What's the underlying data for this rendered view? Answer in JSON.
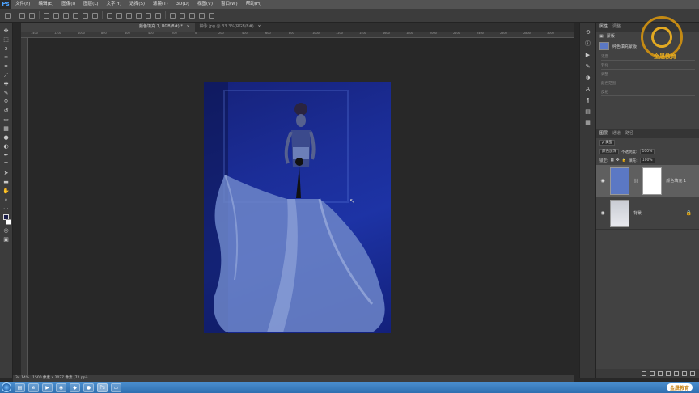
{
  "app": {
    "logo": "Ps"
  },
  "menu": [
    "文件(F)",
    "编辑(E)",
    "图像(I)",
    "图层(L)",
    "文字(Y)",
    "选择(S)",
    "滤镜(T)",
    "3D(D)",
    "视图(V)",
    "窗口(W)",
    "帮助(H)"
  ],
  "tabs": [
    {
      "label": "颜色填充 1, RGB/8#) *",
      "close": "×"
    },
    {
      "label": "钟泳.jpg @ 33.3%(RGB/8#)",
      "close": "×"
    }
  ],
  "ruler_ticks": [
    "1400",
    "1200",
    "1000",
    "800",
    "600",
    "400",
    "200",
    "0",
    "200",
    "400",
    "600",
    "800",
    "1000",
    "1200",
    "1400",
    "1600",
    "1800",
    "2000",
    "2200",
    "2400",
    "2600",
    "2800",
    "3000"
  ],
  "status": {
    "zoom": "34.14%",
    "doc_size": "1500 像素 x 2027 像素 (72 ppi)"
  },
  "properties": {
    "tabs": [
      "属性",
      "调整"
    ],
    "header_label": "蒙版",
    "fill_label": "纯色填充蒙版",
    "fields": [
      "浓度",
      "羽化",
      "调整",
      "颜色范围",
      "反相"
    ]
  },
  "layers": {
    "tabs": [
      "图层",
      "通道",
      "路径"
    ],
    "filter_label": "ρ 类型",
    "blend_mode": "颜色加深",
    "opacity_label": "不透明度:",
    "opacity_value": "100%",
    "lock_label": "锁定:",
    "fill_label": "填充:",
    "fill_value": "100%",
    "items": [
      {
        "name": "颜色填充 1",
        "selected": true
      },
      {
        "name": "背景",
        "selected": false
      }
    ]
  },
  "watermark": {
    "text": "金晟教育"
  },
  "taskbar": {
    "brand": "金晟教育"
  },
  "colors": {
    "foreground": "#1c1f4a",
    "background": "#ffffff",
    "fill_thumb": "#5b78c4"
  }
}
